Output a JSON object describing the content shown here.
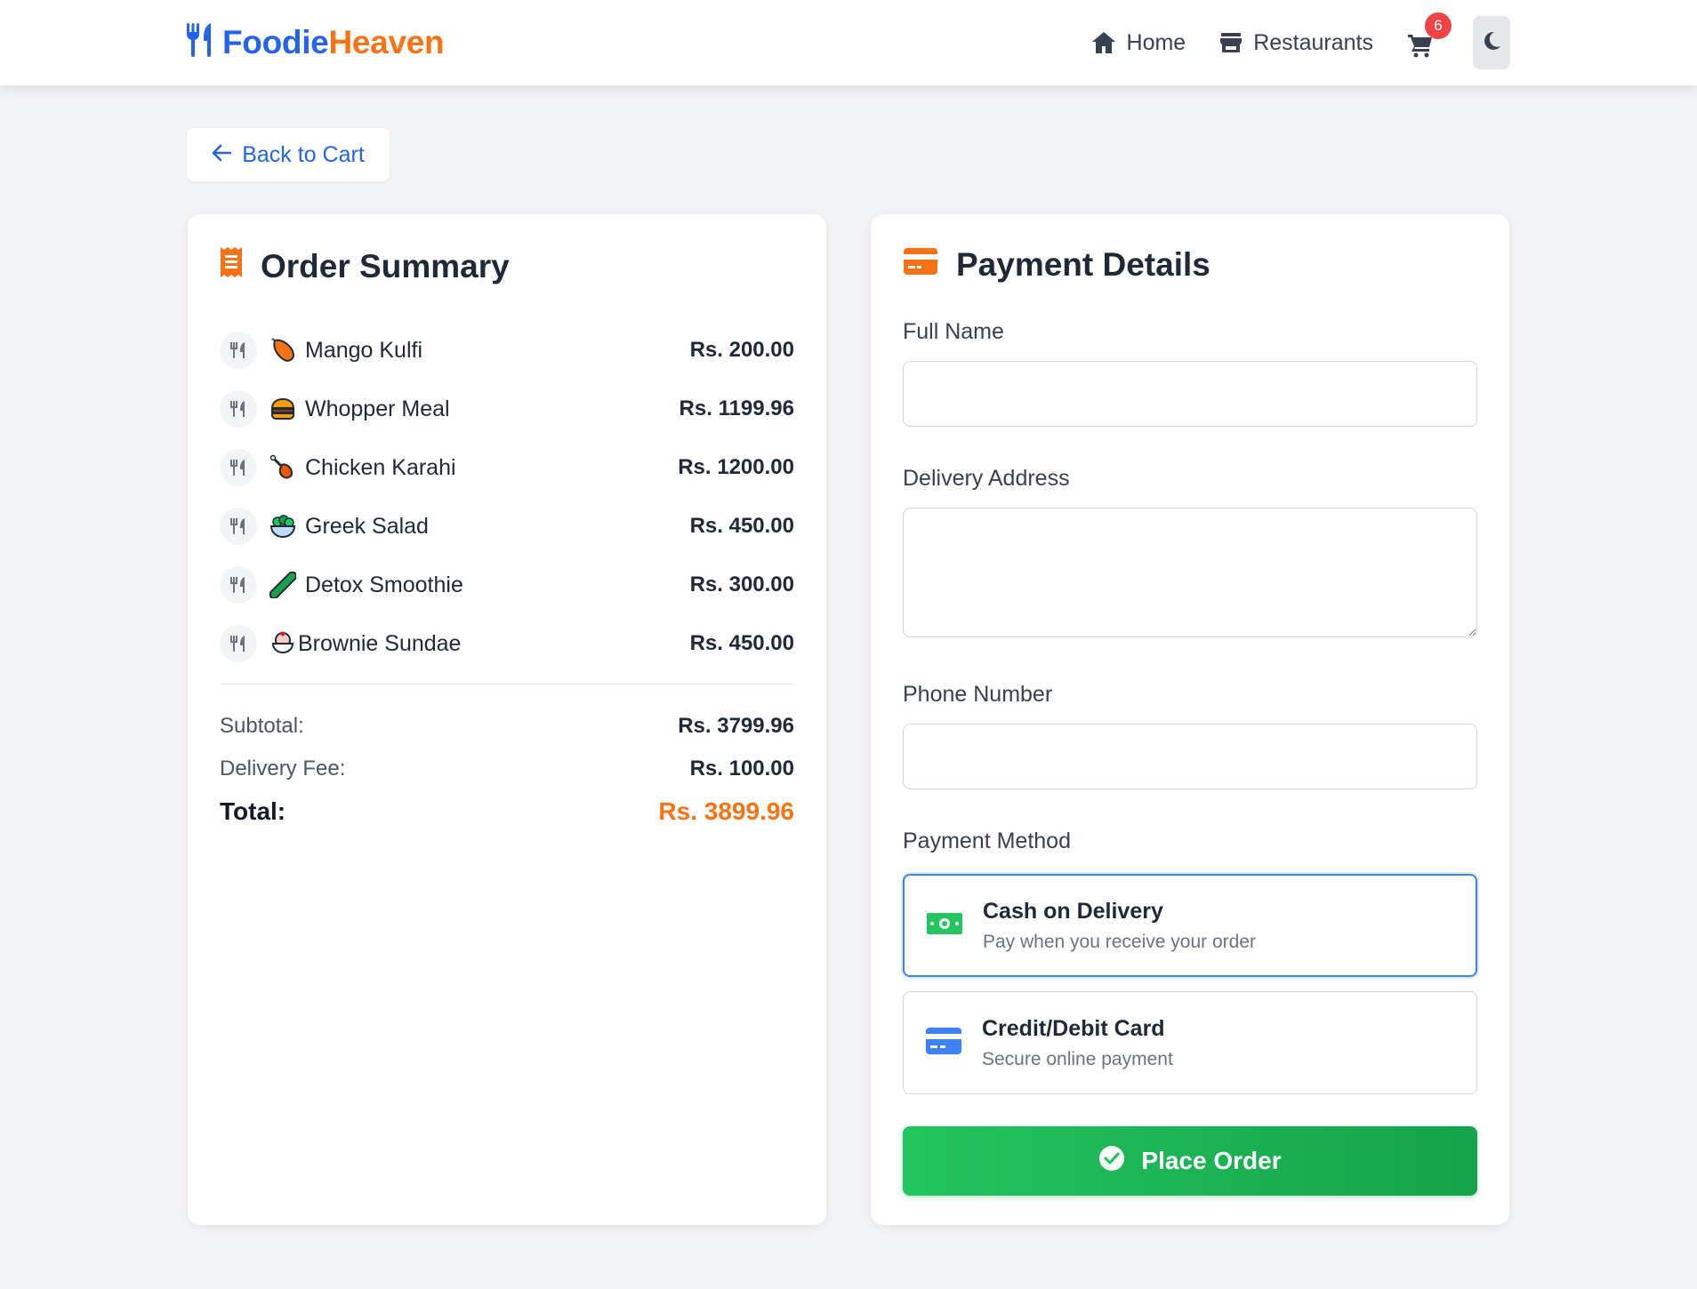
{
  "brand": {
    "part1": "Foodie",
    "part2": "Heaven"
  },
  "nav": {
    "home": "Home",
    "restaurants": "Restaurants",
    "cart_count": "6"
  },
  "back_button": "Back to Cart",
  "order_summary": {
    "title": "Order Summary",
    "items": [
      {
        "name": "Mango Kulfi",
        "price": "Rs. 200.00",
        "emoji_icon": "mango-icon"
      },
      {
        "name": "Whopper Meal",
        "price": "Rs. 1199.96",
        "emoji_icon": "burger-icon"
      },
      {
        "name": "Chicken Karahi",
        "price": "Rs. 1200.00",
        "emoji_icon": "chicken-leg-icon"
      },
      {
        "name": "Greek Salad",
        "price": "Rs. 450.00",
        "emoji_icon": "salad-icon"
      },
      {
        "name": "Detox Smoothie",
        "price": "Rs. 300.00",
        "emoji_icon": "cucumber-icon"
      },
      {
        "name": "Brownie Sundae",
        "price": "Rs. 450.00",
        "emoji_icon": "sundae-icon"
      }
    ],
    "subtotal_label": "Subtotal:",
    "subtotal": "Rs. 3799.96",
    "delivery_label": "Delivery Fee:",
    "delivery": "Rs. 100.00",
    "total_label": "Total:",
    "total": "Rs. 3899.96"
  },
  "payment": {
    "title": "Payment Details",
    "full_name_label": "Full Name",
    "full_name_value": "",
    "address_label": "Delivery Address",
    "address_value": "",
    "phone_label": "Phone Number",
    "phone_value": "",
    "method_label": "Payment Method",
    "options": [
      {
        "title": "Cash on Delivery",
        "subtitle": "Pay when you receive your order",
        "selected": true
      },
      {
        "title": "Credit/Debit Card",
        "subtitle": "Secure online payment",
        "selected": false
      }
    ],
    "submit": "Place Order"
  },
  "colors": {
    "primary": "#2563eb",
    "accent": "#f97316",
    "success": "#22c55e",
    "badge": "#ef4444"
  }
}
